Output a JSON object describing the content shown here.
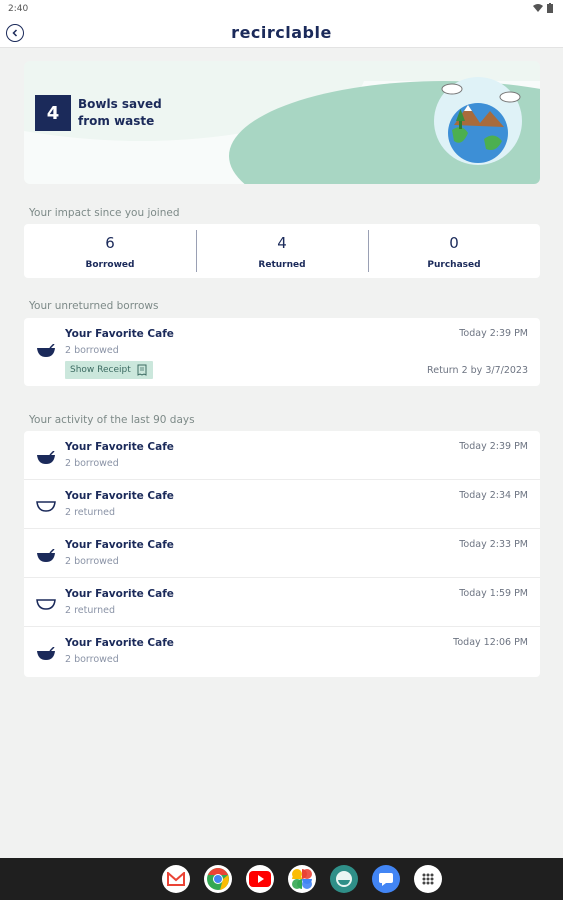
{
  "status": {
    "time": "2:40"
  },
  "header": {
    "logo": "recirclable"
  },
  "hero": {
    "count": "4",
    "text": "Bowls saved from waste"
  },
  "impact": {
    "label": "Your impact since you joined",
    "stats": [
      {
        "value": "6",
        "label": "Borrowed"
      },
      {
        "value": "4",
        "label": "Returned"
      },
      {
        "value": "0",
        "label": "Purchased"
      }
    ]
  },
  "unreturned": {
    "label": "Your unreturned borrows",
    "item": {
      "title": "Your Favorite Cafe",
      "sub": "2 borrowed",
      "time": "Today 2:39 PM",
      "receipt": "Show Receipt",
      "return_text": "Return 2 by 3/7/2023"
    }
  },
  "activity": {
    "label": "Your activity of the last 90 days",
    "items": [
      {
        "title": "Your Favorite Cafe",
        "sub": "2 borrowed",
        "time": "Today 2:39 PM",
        "icon": "filled-bowl-icon"
      },
      {
        "title": "Your Favorite Cafe",
        "sub": "2 returned",
        "time": "Today 2:34 PM",
        "icon": "empty-bowl-icon"
      },
      {
        "title": "Your Favorite Cafe",
        "sub": "2 borrowed",
        "time": "Today 2:33 PM",
        "icon": "filled-bowl-icon"
      },
      {
        "title": "Your Favorite Cafe",
        "sub": "2 returned",
        "time": "Today 1:59 PM",
        "icon": "empty-bowl-icon"
      },
      {
        "title": "Your Favorite Cafe",
        "sub": "2 borrowed",
        "time": "Today 12:06 PM",
        "icon": "filled-bowl-icon"
      }
    ]
  },
  "colors": {
    "brand": "#1b2a5a",
    "accent_green": "#9fd2bd",
    "background": "#f1f2f1"
  },
  "dock": [
    "gmail-icon",
    "chrome-icon",
    "youtube-icon",
    "photos-icon",
    "app-icon",
    "messages-icon",
    "apps-grid-icon"
  ]
}
